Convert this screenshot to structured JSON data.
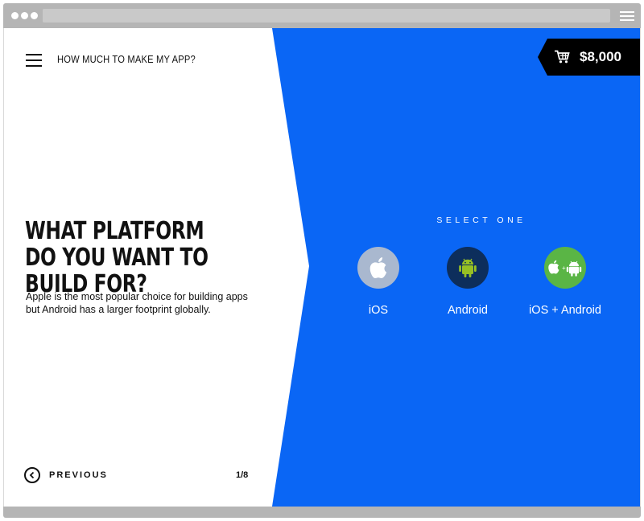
{
  "header": {
    "app_title": "HOW MUCH TO MAKE MY APP?",
    "cart_total": "$8,000"
  },
  "question": {
    "title": "WHAT PLATFORM DO YOU WANT TO BUILD FOR?",
    "description": "Apple is the most popular choice for building apps but Android has a larger footprint globally."
  },
  "footer": {
    "previous_label": "PREVIOUS",
    "page_indicator": "1/8"
  },
  "selection": {
    "prompt": "SELECT ONE",
    "options": [
      {
        "label": "iOS",
        "icon": "apple-icon",
        "color": "#a9b8cf"
      },
      {
        "label": "Android",
        "icon": "android-icon",
        "color": "#0d2e5c"
      },
      {
        "label": "iOS + Android",
        "icon": "apple-android-icon",
        "color": "#5ab545"
      }
    ]
  },
  "colors": {
    "accent_blue": "#0a66f5",
    "android_green": "#97c024",
    "cart_background": "#000000"
  }
}
